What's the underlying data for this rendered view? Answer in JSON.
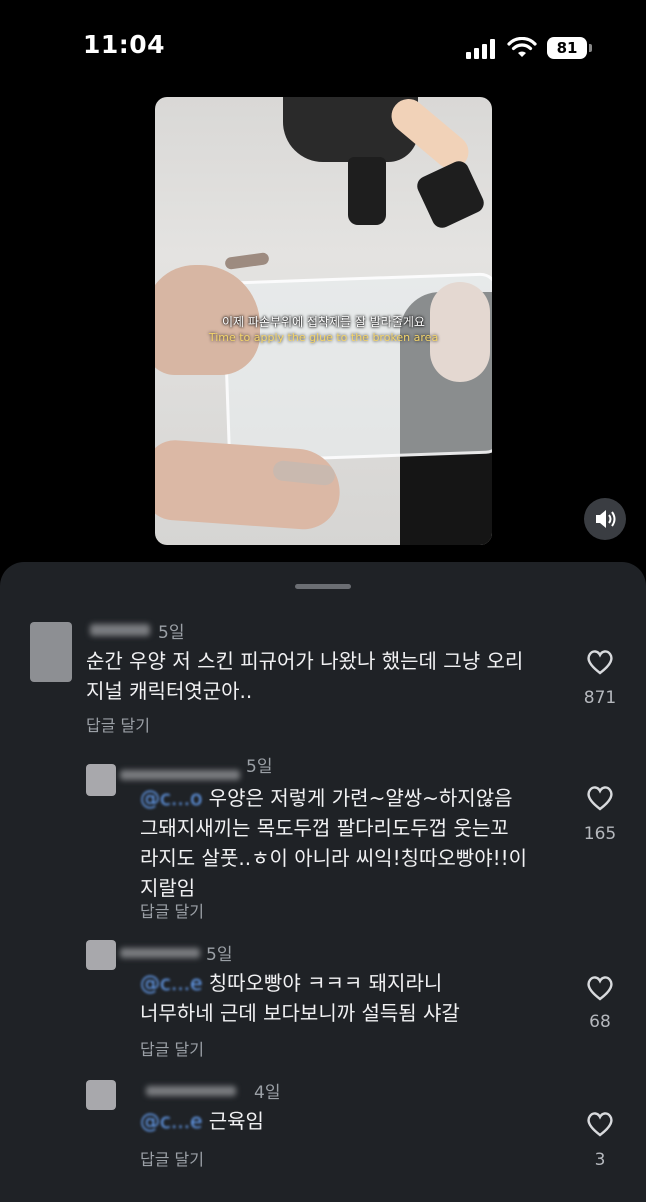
{
  "status": {
    "time": "11:04",
    "battery": "81"
  },
  "video": {
    "subtitle_ko": "이제 파손부위에 접착제를 잘 발라줄게요",
    "subtitle_en": "Time to apply the glue to the broken area"
  },
  "comments": [
    {
      "date": "5일",
      "text_lines": [
        "순간 우양 저 스킨 피규어가 나왔나 했는데 그냥 오리",
        "지널 캐릭터엿군아.."
      ],
      "reply_label": "답글 달기",
      "likes": "871"
    },
    {
      "date": "5일",
      "text_lines": [
        "우양은 저렇게 가련~얄쌍~하지않음",
        "그돼지새끼는 목도두껍 팔다리도두껍 웃는꼬",
        "라지도 살풋..ㅎ이 아니라 씨익!칭따오빵야!!이",
        "지랄임"
      ],
      "reply_label": "답글 달기",
      "likes": "165"
    },
    {
      "date": "5일",
      "text_lines": [
        "칭따오빵야 ㅋㅋㅋ 돼지라니",
        "너무하네 근데 보다보니까 설득됨 샤갈"
      ],
      "reply_label": "답글 달기",
      "likes": "68"
    },
    {
      "date": "4일",
      "text_lines": [
        "근육임"
      ],
      "reply_label": "답글 달기",
      "likes": "3"
    }
  ]
}
